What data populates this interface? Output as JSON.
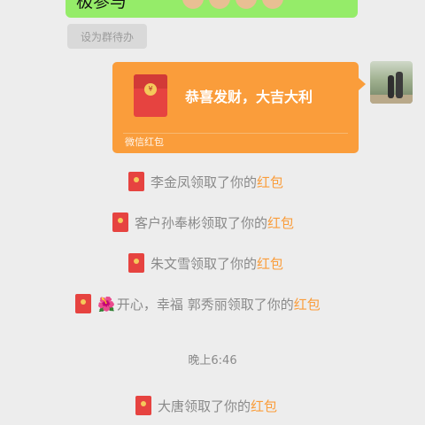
{
  "partial_message": {
    "text": "极参与"
  },
  "todo_button": {
    "label": "设为群待办"
  },
  "red_packet": {
    "title": "恭喜发财，大吉大利",
    "footer": "微信红包",
    "seal": "¥"
  },
  "notices": [
    {
      "name": "李金凤",
      "action": "领取了你的",
      "link": "红包"
    },
    {
      "name": "客户孙奉彬",
      "action": "领取了你的",
      "link": "红包"
    },
    {
      "name": "朱文雪",
      "action": "领取了你的",
      "link": "红包"
    },
    {
      "prefix": "🌺",
      "name": "开心，幸福  郭秀丽",
      "action": "领取了你的",
      "link": "红包"
    },
    {
      "name": "大唐",
      "action": "领取了你的",
      "link": "红包"
    }
  ],
  "timestamp": "晚上6:46"
}
